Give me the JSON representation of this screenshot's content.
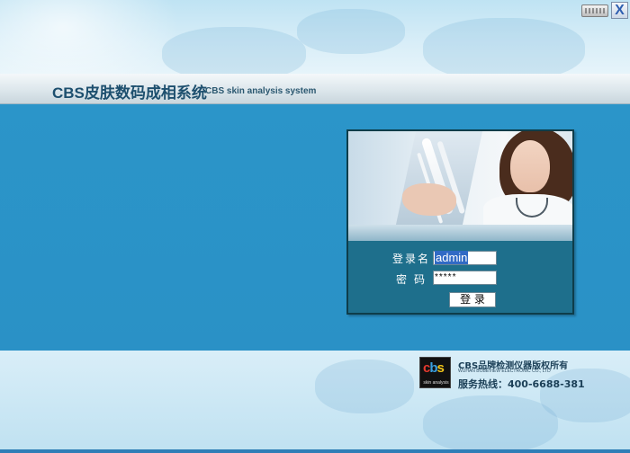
{
  "header": {
    "title_cn": "CBS皮肤数码成相系统",
    "title_en": "CBS skin analysis system"
  },
  "window_controls": {
    "close_label": "X",
    "keyboard_icon": "keyboard-icon"
  },
  "login": {
    "username_label": "登录名",
    "username_value": "admin",
    "password_label": "密码",
    "password_value": "*****",
    "submit_label": "登 录"
  },
  "footer": {
    "logo_text_c": "c",
    "logo_text_b": "b",
    "logo_text_s": "s",
    "logo_tag": "skin analysis",
    "copyright": "CBS品牌检测仪器版权所有",
    "company": "WUHAN BOBEVIEW ELECTRONIC CO., LTD",
    "hotline": "服务热线：400-6688-381"
  },
  "colors": {
    "main_blue": "#2b95c9",
    "panel_blue": "#1e6f8c",
    "title_text": "#1d4f6e"
  }
}
